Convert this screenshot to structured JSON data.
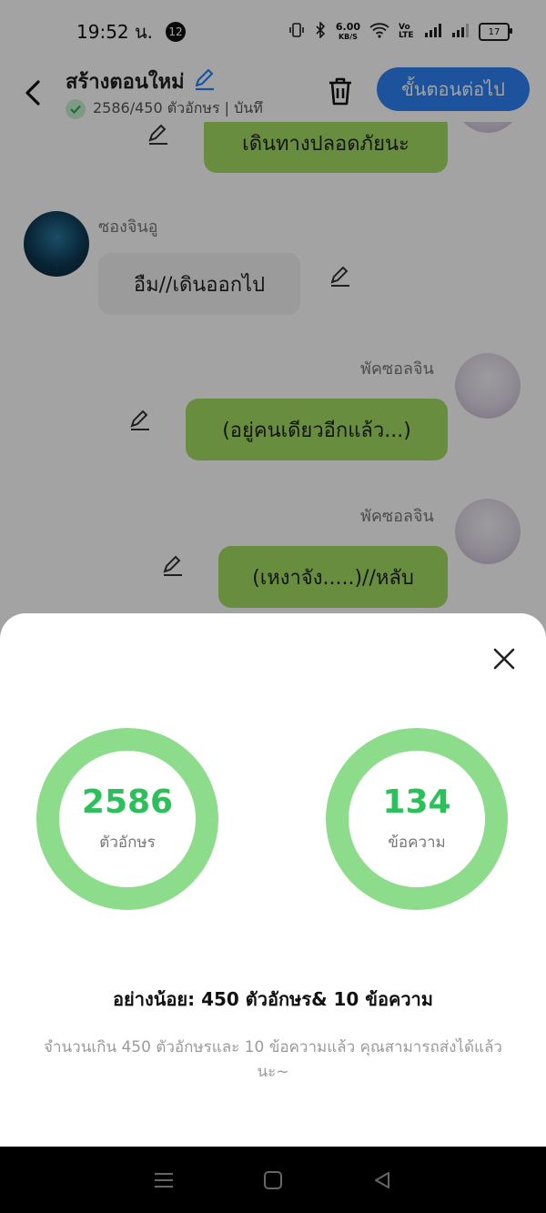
{
  "status_bar": {
    "time": "19:52 น.",
    "notification_count": "12",
    "net_speed_value": "6.00",
    "net_speed_unit": "KB/S",
    "volte_label": "Vo LTE",
    "battery_level": "17"
  },
  "header": {
    "title": "สร้างตอนใหม่",
    "count_status": "2586/450 ตัวอักษร | บันทึ",
    "next_button_label": "ขั้นตอนต่อไป"
  },
  "chat": {
    "messages": [
      {
        "sender": "",
        "text": "เดินทางปลอดภัยนะ",
        "side": "right"
      },
      {
        "sender": "ซองจินอู",
        "text": "อืม//เดินออกไป",
        "side": "left"
      },
      {
        "sender": "พัคซอลจิน",
        "text": "(อยู่คนเดียวอีกแล้ว...)",
        "side": "right"
      },
      {
        "sender": "พัคซอลจิน",
        "text": "(เหงาจัง.....)//หลับ",
        "side": "right"
      }
    ]
  },
  "sheet": {
    "characters": {
      "value": "2586",
      "label": "ตัวอักษร"
    },
    "messages": {
      "value": "134",
      "label": "ข้อความ"
    },
    "minimum_text": "อย่างน้อย: 450 ตัวอักษร& 10 ข้อความ",
    "hint_text": "จำนวนเกิน 450 ตัวอักษรและ 10 ข้อความแล้ว คุณสามารถส่งได้แล้วนะ~"
  },
  "colors": {
    "accent_blue": "#2d83f5",
    "bubble_green": "#a5dd63",
    "ring_green": "#8ddc8c",
    "value_green": "#2cc05a"
  }
}
